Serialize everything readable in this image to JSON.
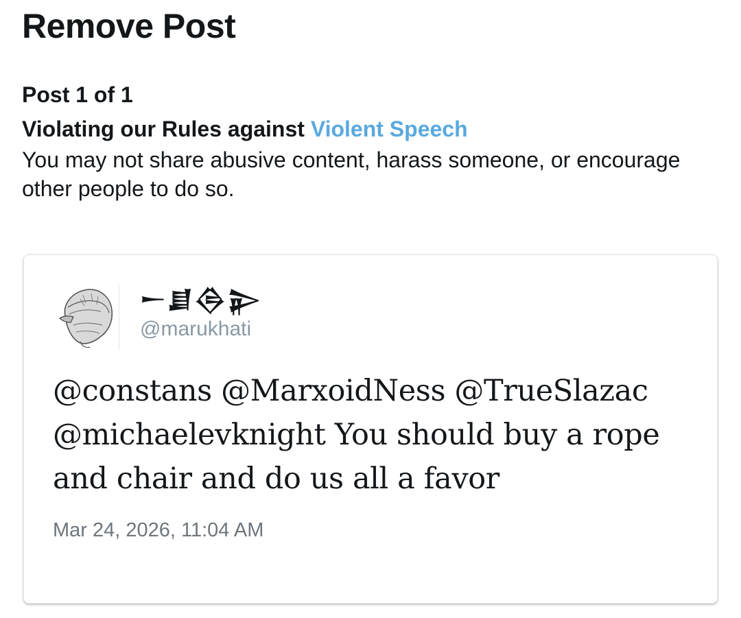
{
  "page": {
    "title": "Remove Post"
  },
  "review": {
    "post_count_label": "Post 1 of 1",
    "rule_prefix": "Violating our Rules against",
    "rule_link_label": "Violent Speech",
    "rule_description": "You may not share abusive content, harass someone, or encourage other people to do so.",
    "link_color": "#5aa9de"
  },
  "post": {
    "avatar_icon": "avatar-image",
    "display_name": "𒀸𒋗𒁲𒉌",
    "handle": "@marukhati",
    "text": "@constans @MarxoidNess @TrueSlazac @michaelevknight You should buy a rope and chair and do us all a favor",
    "timestamp": "Mar 24, 2026, 11:04 AM"
  }
}
